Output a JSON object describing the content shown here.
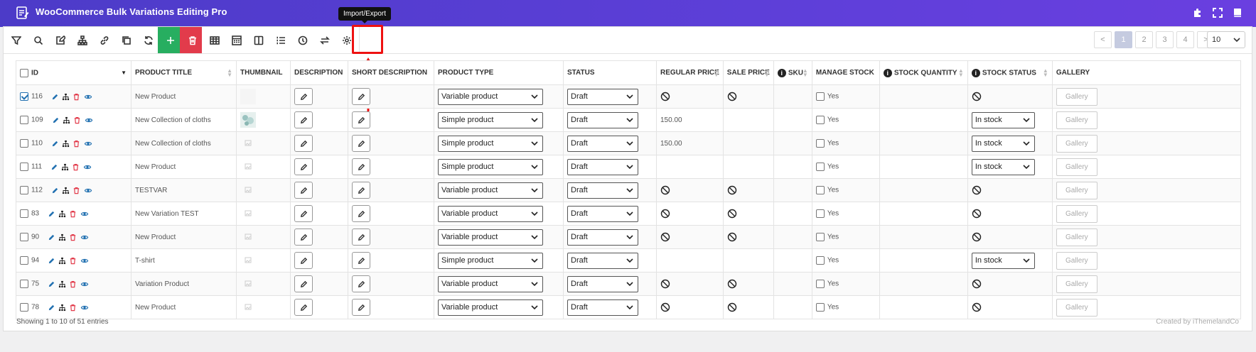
{
  "app": {
    "title": "WooCommerce Bulk Variations Editing Pro"
  },
  "tooltip": "Import/Export",
  "toolbar": {
    "buttons": [
      {
        "name": "filter-button",
        "icon": "filter-icon"
      },
      {
        "name": "search-button",
        "icon": "search-icon"
      },
      {
        "name": "edit-button",
        "icon": "edit-icon"
      },
      {
        "name": "variations-button",
        "icon": "sitemap-icon"
      },
      {
        "name": "link-button",
        "icon": "link-icon"
      },
      {
        "name": "duplicate-button",
        "icon": "copy-icon"
      },
      {
        "name": "refresh-button",
        "icon": "refresh-icon"
      },
      {
        "name": "add-button",
        "icon": "plus-icon"
      },
      {
        "name": "delete-button",
        "icon": "trash-icon"
      },
      {
        "name": "columns-button",
        "icon": "table-icon"
      },
      {
        "name": "calculator-button",
        "icon": "calculator-icon"
      },
      {
        "name": "column-profile-button",
        "icon": "columns-icon"
      },
      {
        "name": "bulk-list-button",
        "icon": "list-icon"
      },
      {
        "name": "history-button",
        "icon": "clock-icon"
      },
      {
        "name": "import-export-button",
        "icon": "exchange-icon"
      },
      {
        "name": "settings-button",
        "icon": "gear-icon"
      }
    ]
  },
  "pagination": {
    "prev": "<",
    "pages": [
      "1",
      "2",
      "3",
      "4"
    ],
    "next": ">",
    "active": "1",
    "per_page": "10"
  },
  "columns": [
    "ID",
    "PRODUCT TITLE",
    "THUMBNAIL",
    "DESCRIPTION",
    "SHORT DESCRIPTION",
    "PRODUCT TYPE",
    "STATUS",
    "REGULAR PRICE",
    "SALE PRICE",
    "SKU",
    "MANAGE STOCK",
    "STOCK QUANTITY",
    "STOCK STATUS",
    "GALLERY"
  ],
  "rows": [
    {
      "id": "116",
      "title": "New Product",
      "thumb": "blank",
      "type": "Variable product",
      "status": "Draft",
      "regular": "",
      "sale": "",
      "variable": true,
      "manage": "Yes",
      "stock_status": "",
      "checked": true
    },
    {
      "id": "109",
      "title": "New Collection of cloths",
      "thumb": "image",
      "type": "Simple product",
      "status": "Draft",
      "regular": "150.00",
      "sale": "",
      "variable": false,
      "manage": "Yes",
      "stock_status": "In stock",
      "checked": false
    },
    {
      "id": "110",
      "title": "New Collection of cloths",
      "thumb": "placeholder",
      "type": "Simple product",
      "status": "Draft",
      "regular": "150.00",
      "sale": "",
      "variable": false,
      "manage": "Yes",
      "stock_status": "In stock",
      "checked": false
    },
    {
      "id": "111",
      "title": "New Product",
      "thumb": "placeholder",
      "type": "Simple product",
      "status": "Draft",
      "regular": "",
      "sale": "",
      "variable": false,
      "manage": "Yes",
      "stock_status": "In stock",
      "checked": false
    },
    {
      "id": "112",
      "title": "TESTVAR",
      "thumb": "placeholder",
      "type": "Variable product",
      "status": "Draft",
      "regular": "",
      "sale": "",
      "variable": true,
      "manage": "Yes",
      "stock_status": "",
      "checked": false
    },
    {
      "id": "83",
      "title": "New Variation TEST",
      "thumb": "placeholder",
      "type": "Variable product",
      "status": "Draft",
      "regular": "",
      "sale": "",
      "variable": true,
      "manage": "Yes",
      "stock_status": "",
      "checked": false
    },
    {
      "id": "90",
      "title": "New Product",
      "thumb": "placeholder",
      "type": "Variable product",
      "status": "Draft",
      "regular": "",
      "sale": "",
      "variable": true,
      "manage": "Yes",
      "stock_status": "",
      "checked": false
    },
    {
      "id": "94",
      "title": "T-shirt",
      "thumb": "placeholder",
      "type": "Simple product",
      "status": "Draft",
      "regular": "",
      "sale": "",
      "variable": false,
      "manage": "Yes",
      "stock_status": "In stock",
      "checked": false
    },
    {
      "id": "75",
      "title": "Variation Product",
      "thumb": "placeholder",
      "type": "Variable product",
      "status": "Draft",
      "regular": "",
      "sale": "",
      "variable": true,
      "manage": "Yes",
      "stock_status": "",
      "checked": false
    },
    {
      "id": "78",
      "title": "New Product",
      "thumb": "placeholder",
      "type": "Variable product",
      "status": "Draft",
      "regular": "",
      "sale": "",
      "variable": true,
      "manage": "Yes",
      "stock_status": "",
      "checked": false
    }
  ],
  "gallery_label": "Gallery",
  "footer": {
    "entries": "Showing 1 to 10 of 51 entries",
    "credit": "Created by iThemelandCo"
  },
  "colors": {
    "header_from": "#4c3bc8",
    "header_to": "#6a3fe0",
    "accent_blue": "#2271b1",
    "delete_red": "#e23b4b",
    "add_green": "#27ae60",
    "highlight": "#ee1111"
  }
}
